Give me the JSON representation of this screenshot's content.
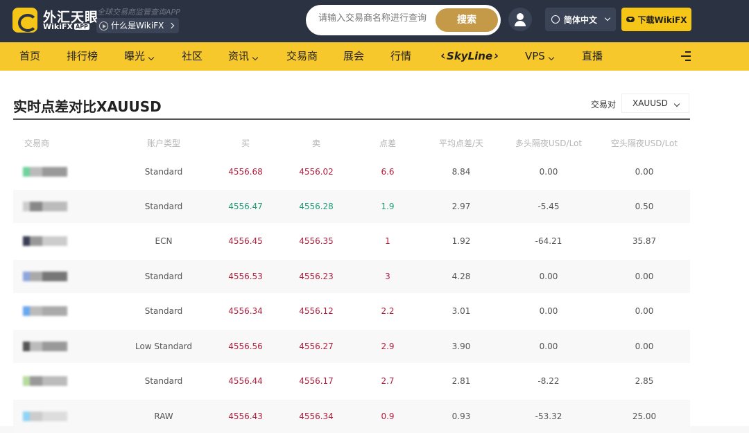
{
  "header": {
    "brand_cn": "外汇天眼",
    "brand_en": "WikiFX",
    "brand_app": "APP",
    "slogan": "全球交易商监管查询APP",
    "what_is": "什么是WikiFX",
    "search_placeholder": "请输入交易商名称进行查询",
    "search_button": "搜索",
    "language": "简体中文",
    "download": "下载WikiFX"
  },
  "nav": {
    "items": [
      "首页",
      "排行榜",
      "曝光",
      "社区",
      "资讯",
      "交易商",
      "展会",
      "行情",
      "SkyLine",
      "VPS",
      "直播"
    ]
  },
  "page": {
    "title": "实时点差对比XAUUSD",
    "pair_label": "交易对",
    "pair_value": "XAUUSD"
  },
  "table": {
    "columns": [
      "交易商",
      "账户类型",
      "买",
      "卖",
      "点差",
      "平均点差/天",
      "多头隔夜USD/Lot",
      "空头隔夜USD/Lot"
    ],
    "rows": [
      {
        "account": "Standard",
        "buy": "4556.68",
        "sell": "4556.02",
        "spread": "6.6",
        "avg": "8.84",
        "long": "0.00",
        "short": "0.00",
        "color": "red"
      },
      {
        "account": "Standard",
        "buy": "4556.47",
        "sell": "4556.28",
        "spread": "1.9",
        "avg": "2.97",
        "long": "-5.45",
        "short": "0.50",
        "color": "green"
      },
      {
        "account": "ECN",
        "buy": "4556.45",
        "sell": "4556.35",
        "spread": "1",
        "avg": "1.92",
        "long": "-64.21",
        "short": "35.87",
        "color": "red"
      },
      {
        "account": "Standard",
        "buy": "4556.53",
        "sell": "4556.23",
        "spread": "3",
        "avg": "4.28",
        "long": "0.00",
        "short": "0.00",
        "color": "red"
      },
      {
        "account": "Standard",
        "buy": "4556.34",
        "sell": "4556.12",
        "spread": "2.2",
        "avg": "3.01",
        "long": "0.00",
        "short": "0.00",
        "color": "red"
      },
      {
        "account": "Low Standard",
        "buy": "4556.56",
        "sell": "4556.27",
        "spread": "2.9",
        "avg": "3.90",
        "long": "0.00",
        "short": "0.00",
        "color": "red"
      },
      {
        "account": "Standard",
        "buy": "4556.44",
        "sell": "4556.17",
        "spread": "2.7",
        "avg": "2.81",
        "long": "-8.22",
        "short": "2.85",
        "color": "red"
      },
      {
        "account": "RAW",
        "buy": "4556.43",
        "sell": "4556.34",
        "spread": "0.9",
        "avg": "0.93",
        "long": "-53.32",
        "short": "25.00",
        "color": "red"
      }
    ]
  },
  "colors": {
    "topbar": "#2b3242",
    "nav_yellow": "#f7c82c",
    "search_gold": "#c49a48",
    "price_red": "#b01e3c",
    "price_green": "#1e9b76"
  },
  "icons": [
    "wikifx-logo-icon",
    "play-icon",
    "user-icon",
    "globe-icon",
    "chevron-down-icon",
    "cloud-download-icon",
    "menu-icon"
  ]
}
